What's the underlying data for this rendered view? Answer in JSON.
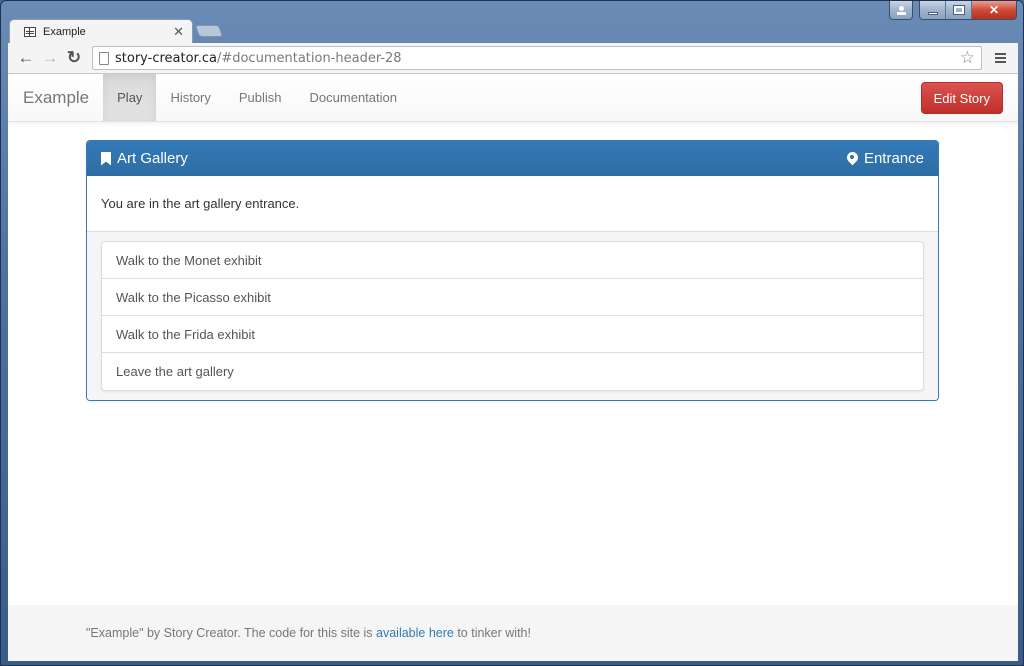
{
  "browser": {
    "tab_title": "Example",
    "url_host": "story-creator.ca",
    "url_path": "/#documentation-header-28",
    "close_glyph": "✕",
    "back_glyph": "←",
    "forward_glyph": "→",
    "reload_glyph": "↻",
    "star_glyph": "☆",
    "window_close_glyph": "✕"
  },
  "navbar": {
    "brand": "Example",
    "items": [
      {
        "label": "Play",
        "active": true
      },
      {
        "label": "History",
        "active": false
      },
      {
        "label": "Publish",
        "active": false
      },
      {
        "label": "Documentation",
        "active": false
      }
    ],
    "edit_button": "Edit Story"
  },
  "panel": {
    "title": "Art Gallery",
    "location": "Entrance",
    "body_text": "You are in the art gallery entrance.",
    "choices": [
      "Walk to the Monet exhibit",
      "Walk to the Picasso exhibit",
      "Walk to the Frida exhibit",
      "Leave the art gallery"
    ]
  },
  "footer": {
    "text_before": "\"Example\" by Story Creator. The code for this site is ",
    "link_text": "available here",
    "text_after": " to tinker with!"
  },
  "colors": {
    "primary": "#337ab7",
    "danger": "#d9534f",
    "link": "#337ab7"
  }
}
